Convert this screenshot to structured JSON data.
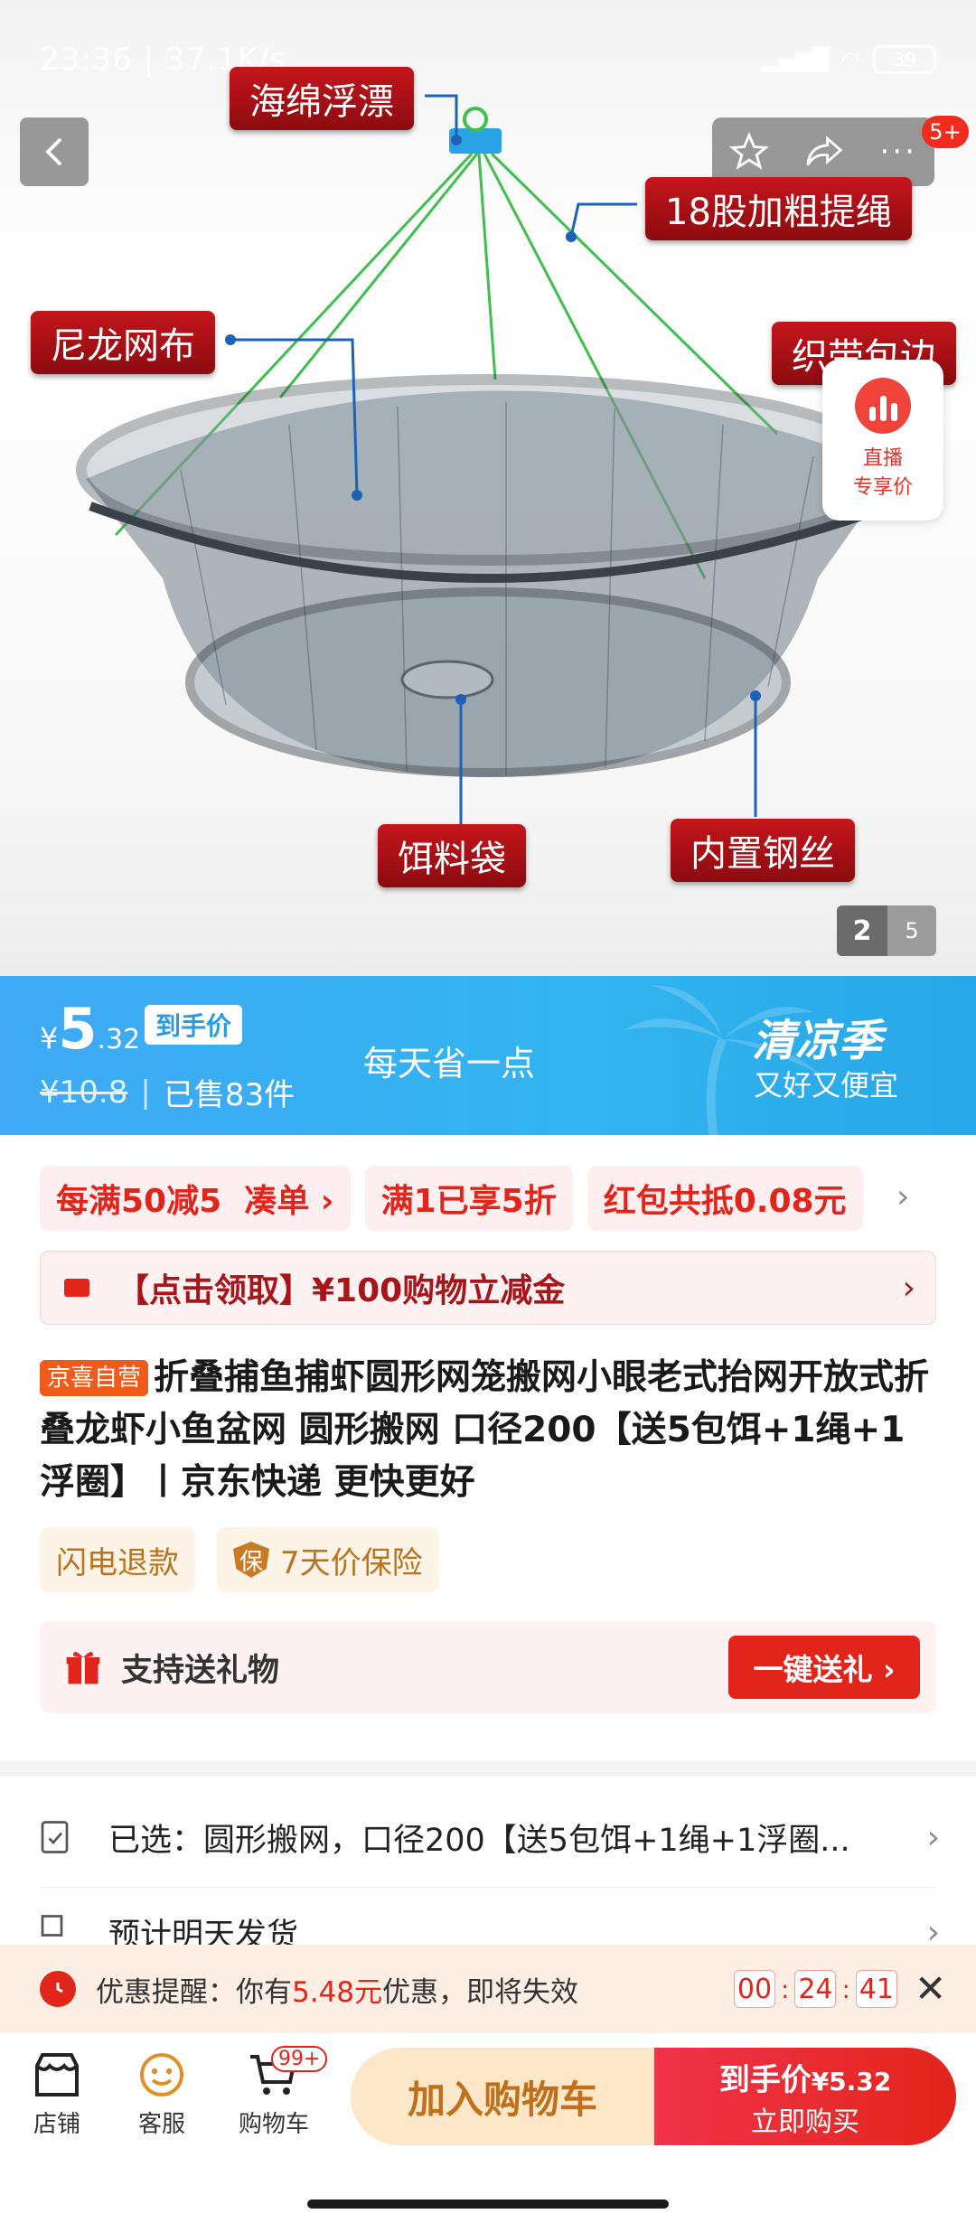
{
  "status_bar": {
    "time": "23:36",
    "speed": "37.1K/s",
    "battery": "39"
  },
  "nav": {
    "badge": "5+"
  },
  "hero": {
    "labels": {
      "float": "海绵浮漂",
      "rope": "18股加粗提绳",
      "nylon": "尼龙网布",
      "binding": "织带包边",
      "bait": "饵料袋",
      "wire": "内置钢丝"
    },
    "live": {
      "line1": "直播",
      "line2": "专享价"
    },
    "page_current": "2",
    "page_total": "5"
  },
  "price": {
    "currency": "¥",
    "integer": "5",
    "decimal": ".32",
    "tag": "到手价",
    "original": "¥10.8",
    "sold": "已售83件",
    "slogan": "每天省一点",
    "promo_title": "清凉季",
    "promo_sub": "又好又便宜"
  },
  "promos": [
    {
      "text": "每满50减5",
      "extra": "凑单 ›"
    },
    {
      "text": "满1已享5折",
      "extra": ""
    },
    {
      "text": "红包共抵0.08元",
      "extra": ""
    }
  ],
  "coupon": {
    "text": "【点击领取】¥100购物立减金"
  },
  "product": {
    "badge": "京喜自营",
    "title": "折叠捕鱼捕虾圆形网笼搬网小眼老式抬网开放式折叠龙虾小鱼盆网 圆形搬网 口径200【送5包饵+1绳+1浮圈】丨京东快递 更快更好"
  },
  "services": [
    {
      "text": "闪电退款"
    },
    {
      "icon_text": "保",
      "text": "7天价保险"
    }
  ],
  "gift": {
    "label": "支持送礼物",
    "button": "一键送礼 ›"
  },
  "selected": {
    "text": "已选：圆形搬网，口径200【送5包饵+1绳+1浮圈..."
  },
  "shipping": {
    "text": "预计明天发货"
  },
  "reminder": {
    "prefix": "优惠提醒：你有",
    "amount": "5.48元",
    "suffix": "优惠，即将失效",
    "countdown": {
      "h": "00",
      "m": "24",
      "s": "41"
    }
  },
  "bottom_bar": {
    "store": "店铺",
    "service": "客服",
    "cart": "购物车",
    "cart_badge": "99+",
    "add_to_cart": "加入购物车",
    "buy_price_label": "到手价",
    "buy_price": "¥5.32",
    "buy_now": "立即购买"
  },
  "colors": {
    "accent": "#e1251b",
    "banner": "#32b4ee",
    "gold": "#c0701a"
  }
}
